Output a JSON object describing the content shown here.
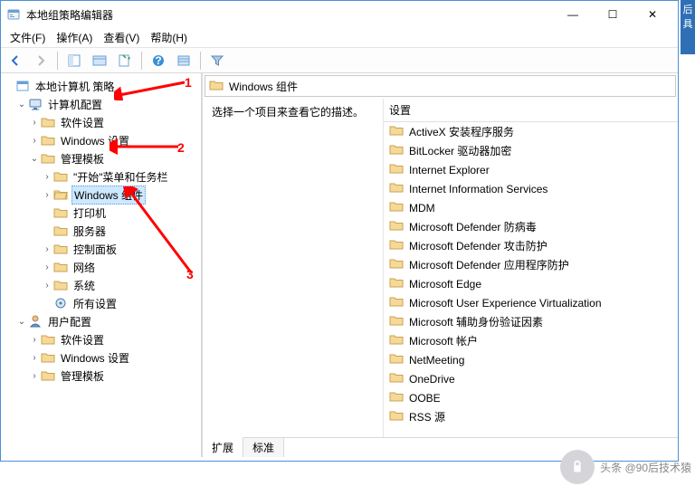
{
  "window": {
    "title": "本地组策略编辑器",
    "min": "—",
    "max": "☐",
    "close": "✕"
  },
  "menu": [
    "文件(F)",
    "操作(A)",
    "查看(V)",
    "帮助(H)"
  ],
  "toolbar_icons": [
    "back-icon",
    "forward-icon",
    "up-icon",
    "show-hide-tree-icon",
    "properties-icon",
    "refresh-icon",
    "export-icon",
    "help-icon",
    "options-icon",
    "filter-icon"
  ],
  "tree": {
    "root": "本地计算机 策略",
    "computer_config": "计算机配置",
    "software_settings": "软件设置",
    "windows_settings": "Windows 设置",
    "admin_templates": "管理模板",
    "start_taskbar": "\"开始\"菜单和任务栏",
    "windows_components": "Windows 组件",
    "printers": "打印机",
    "server": "服务器",
    "control_panel": "控制面板",
    "network": "网络",
    "system": "系统",
    "all_settings": "所有设置",
    "user_config": "用户配置",
    "u_software_settings": "软件设置",
    "u_windows_settings": "Windows 设置",
    "u_admin_templates": "管理模板"
  },
  "location": "Windows 组件",
  "description_prompt": "选择一个项目来查看它的描述。",
  "column_header": "设置",
  "items": [
    "ActiveX 安装程序服务",
    "BitLocker 驱动器加密",
    "Internet Explorer",
    "Internet Information Services",
    "MDM",
    "Microsoft Defender 防病毒",
    "Microsoft Defender 攻击防护",
    "Microsoft Defender 应用程序防护",
    "Microsoft Edge",
    "Microsoft User Experience Virtualization",
    "Microsoft 辅助身份验证因素",
    "Microsoft 帐户",
    "NetMeeting",
    "OneDrive",
    "OOBE",
    "RSS 源"
  ],
  "tabs": {
    "extended": "扩展",
    "standard": "标准"
  },
  "annotations": {
    "a1": "1",
    "a2": "2",
    "a3": "3"
  },
  "watermark": "头条 @90后技术猿",
  "side_strip": "后具"
}
